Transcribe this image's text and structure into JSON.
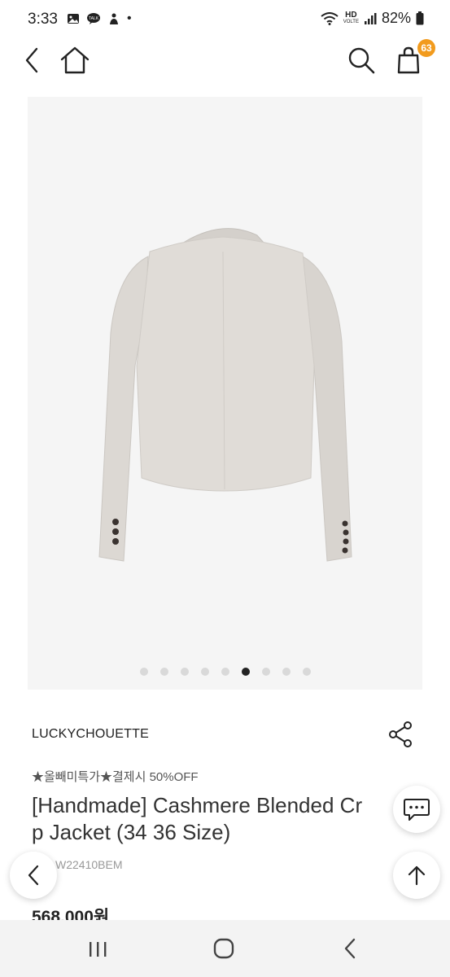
{
  "status": {
    "time": "3:33",
    "dot": "•",
    "network": "HD",
    "network_sub": "VOLTE",
    "battery": "82%"
  },
  "header": {
    "cart_count": "63",
    "icons": [
      "back-icon",
      "home-icon",
      "search-icon",
      "shopping-bag-icon"
    ]
  },
  "product": {
    "image_count": 9,
    "active_image_index": 5,
    "brand": "LUCKYCHOUETTE",
    "promo": "★올빼미특가★결제시 50%OFF",
    "title": "[Handmade] Cashmere Blended Crop Jacket (34 36 Size)",
    "title_line1": "[Handmade] Cashmere Blended Cr",
    "title_line2": "p Jacket (34 36 Size)",
    "code_visible": "W22410BEM",
    "price": "568,000원"
  },
  "floating": {
    "icons": [
      "prev-arrow-icon",
      "chat-icon",
      "scroll-top-icon"
    ]
  },
  "navbar": {
    "icons": [
      "recent-apps-icon",
      "home-circle-icon",
      "back-nav-icon"
    ]
  },
  "colors": {
    "badge": "#f29b1d",
    "image_bg": "#f5f5f5",
    "jacket": "#dcd8d3"
  }
}
